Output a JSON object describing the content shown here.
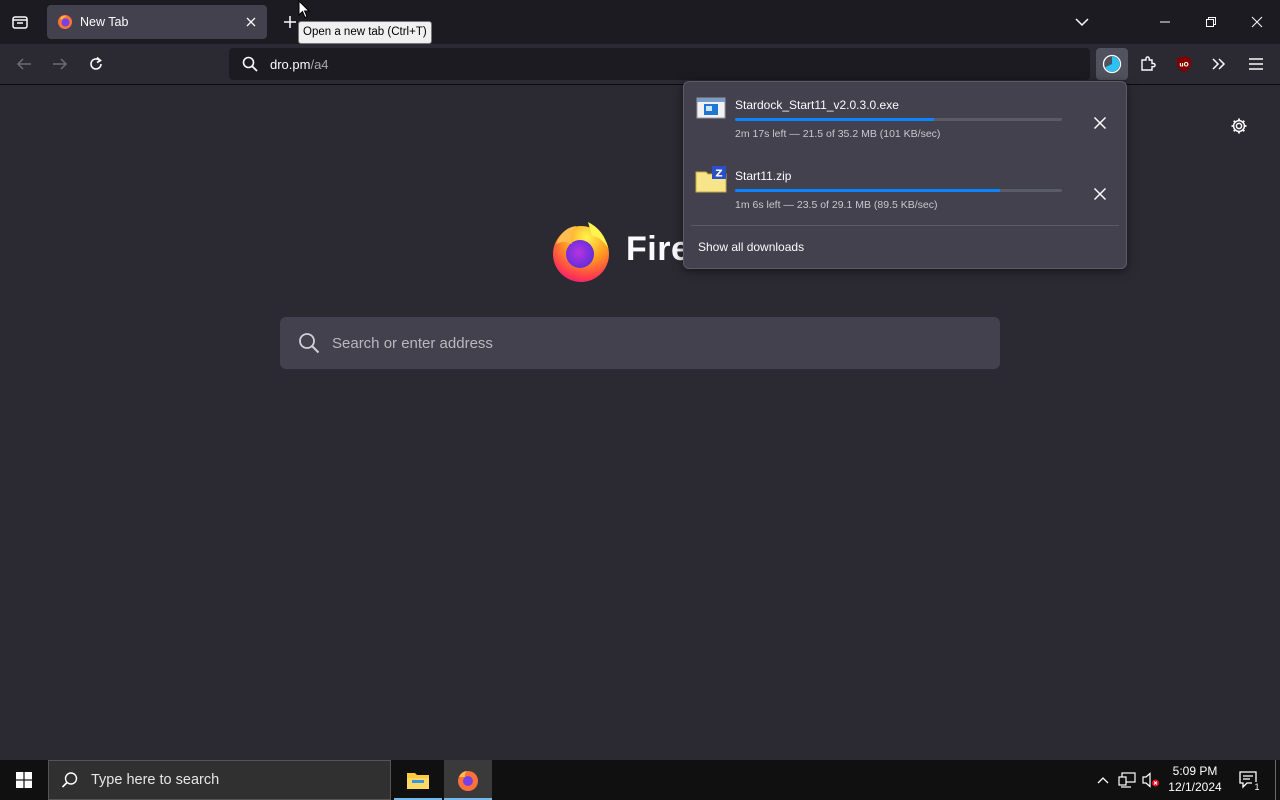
{
  "browser": {
    "tab": {
      "title": "New Tab",
      "new_tab_tooltip": "Open a new tab (Ctrl+T)"
    },
    "urlbar": {
      "host": "dro.pm",
      "path": "/a4"
    }
  },
  "newtab_page": {
    "brand": "Fire",
    "search_placeholder": "Search or enter address"
  },
  "downloads": {
    "items": [
      {
        "name": "Stardock_Start11_v2.0.3.0.exe",
        "status": "2m 17s left — 21.5 of 35.2 MB (101 KB/sec)",
        "progress": 0.61,
        "icon": "exe-file-icon"
      },
      {
        "name": "Start11.zip",
        "status": "1m 6s left — 23.5 of 29.1 MB (89.5 KB/sec)",
        "progress": 0.81,
        "icon": "zip-file-icon"
      }
    ],
    "show_all_label": "Show all downloads"
  },
  "taskbar": {
    "search_placeholder": "Type here to search",
    "time": "5:09 PM",
    "date": "12/1/2024",
    "notification_count": "1"
  },
  "colors": {
    "accent": "#0a84ff",
    "chrome_dark": "#1c1b22",
    "content_bg": "#2b2a33",
    "panel_bg": "#42414d"
  }
}
